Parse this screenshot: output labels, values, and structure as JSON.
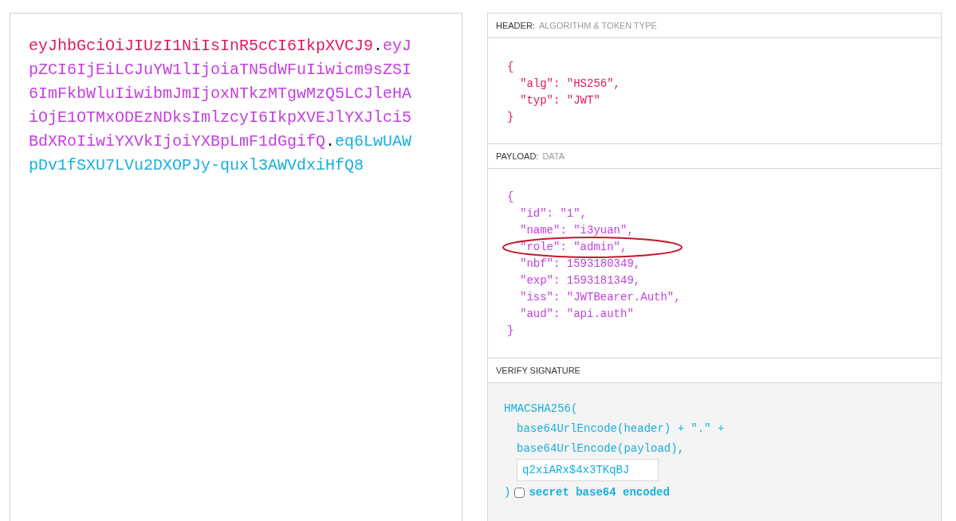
{
  "encoded": {
    "segments": [
      {
        "kind": "header",
        "text": "eyJhbGciOiJIUzI1NiIsInR5cCI6IkpXVCJ9"
      },
      {
        "kind": "separator",
        "text": "."
      },
      {
        "kind": "payload",
        "text": "eyJpZCI6IjEiLCJuYW1lIjoiaTN5dWFuIiwicm9sZSI6ImFkbWluIiwibmJmIjoxNTkzMTgwMzQ5LCJleHAiOjE1OTMxODEzNDksImlzcyI6IkpXVEJlYXJlci5BdXRoIiwiYXVkIjoiYXBpLmF1dGgifQ"
      },
      {
        "kind": "separator",
        "text": "."
      },
      {
        "kind": "signature",
        "text": "eq6LwUAWpDv1fSXU7LVu2DXOPJy-quxl3AWVdxiHfQ8"
      }
    ]
  },
  "header": {
    "title": "HEADER:",
    "subtitle": "ALGORITHM & TOKEN TYPE",
    "open": "{",
    "entries": [
      {
        "text": "\"alg\": \"HS256\","
      },
      {
        "text": "\"typ\": \"JWT\""
      }
    ],
    "close": "}"
  },
  "payload": {
    "title": "PAYLOAD:",
    "subtitle": "DATA",
    "open": "{",
    "entries": [
      {
        "text": "\"id\": \"1\",",
        "circled": false
      },
      {
        "text": "\"name\": \"i3yuan\",",
        "circled": false
      },
      {
        "text": "\"role\": \"admin\",",
        "circled": true
      },
      {
        "text": "\"nbf\": 1593180349,",
        "circled": false
      },
      {
        "text": "\"exp\": 1593181349,",
        "circled": false
      },
      {
        "text": "\"iss\": \"JWTBearer.Auth\",",
        "circled": false
      },
      {
        "text": "\"aud\": \"api.auth\"",
        "circled": false
      }
    ],
    "close": "}"
  },
  "verify_signature": {
    "title": "VERIFY SIGNATURE",
    "call": "HMACSHA256(",
    "arguments": [
      "base64UrlEncode(header) + \".\" +",
      "base64UrlEncode(payload),"
    ],
    "secret": {
      "value": "q2xiARx$4x3TKqBJ"
    },
    "close": ")",
    "base64_option": {
      "label": "secret base64 encoded",
      "checked": false
    }
  }
}
